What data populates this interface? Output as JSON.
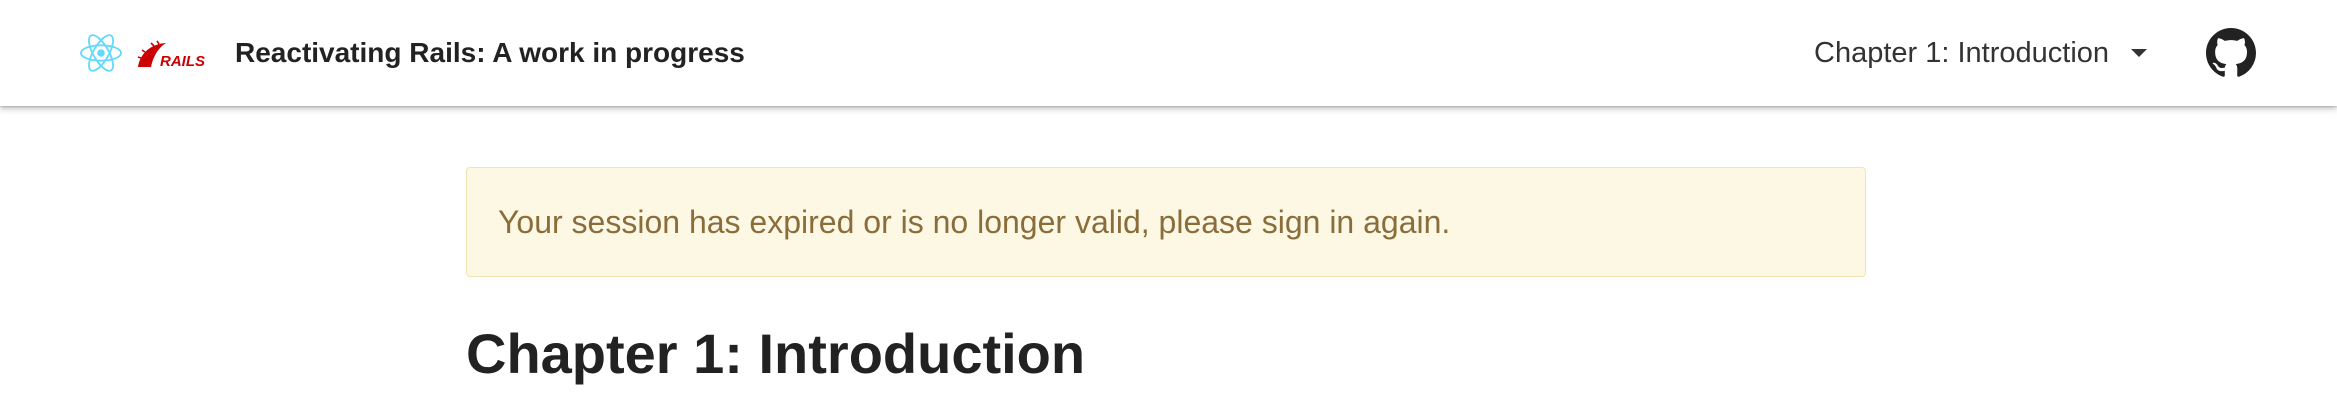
{
  "navbar": {
    "title": "Reactivating Rails: A work in progress",
    "chapter_select": {
      "selected": "Chapter 1: Introduction"
    },
    "logos": {
      "react": {
        "icon": "react-logo-icon",
        "color": "#61dafb"
      },
      "rails": {
        "text": "RAILS",
        "color": "#cc0000"
      }
    },
    "github_icon": "github-icon"
  },
  "alert": {
    "message": "Your session has expired or is no longer valid, please sign in again.",
    "background": "#fcf8e3",
    "text_color": "#8a6d3b"
  },
  "main": {
    "heading": "Chapter 1: Introduction"
  }
}
